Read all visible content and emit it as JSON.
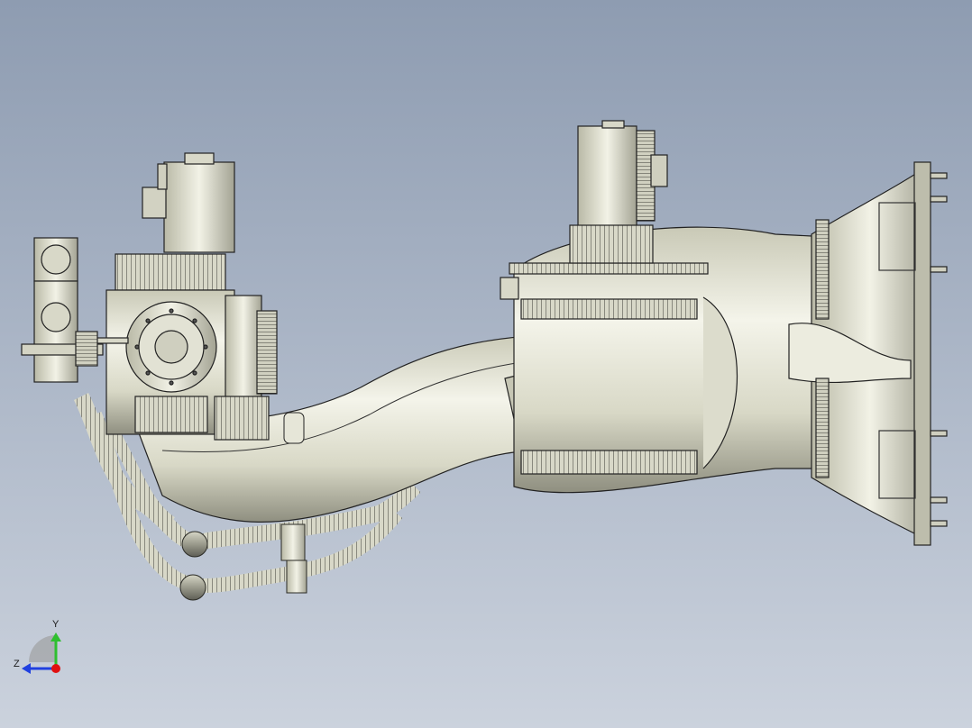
{
  "viewport": {
    "background_top": "#8e9cb1",
    "background_bottom": "#cbd2dd"
  },
  "model": {
    "name_icon": "robot-arm-model",
    "shade_color": "#e8e8dc",
    "edge_color": "#202020"
  },
  "triad": {
    "y_label": "Y",
    "z_label": "Z",
    "y_color": "#2fbf2f",
    "z_color": "#2040e0",
    "origin_color": "#e01010"
  }
}
